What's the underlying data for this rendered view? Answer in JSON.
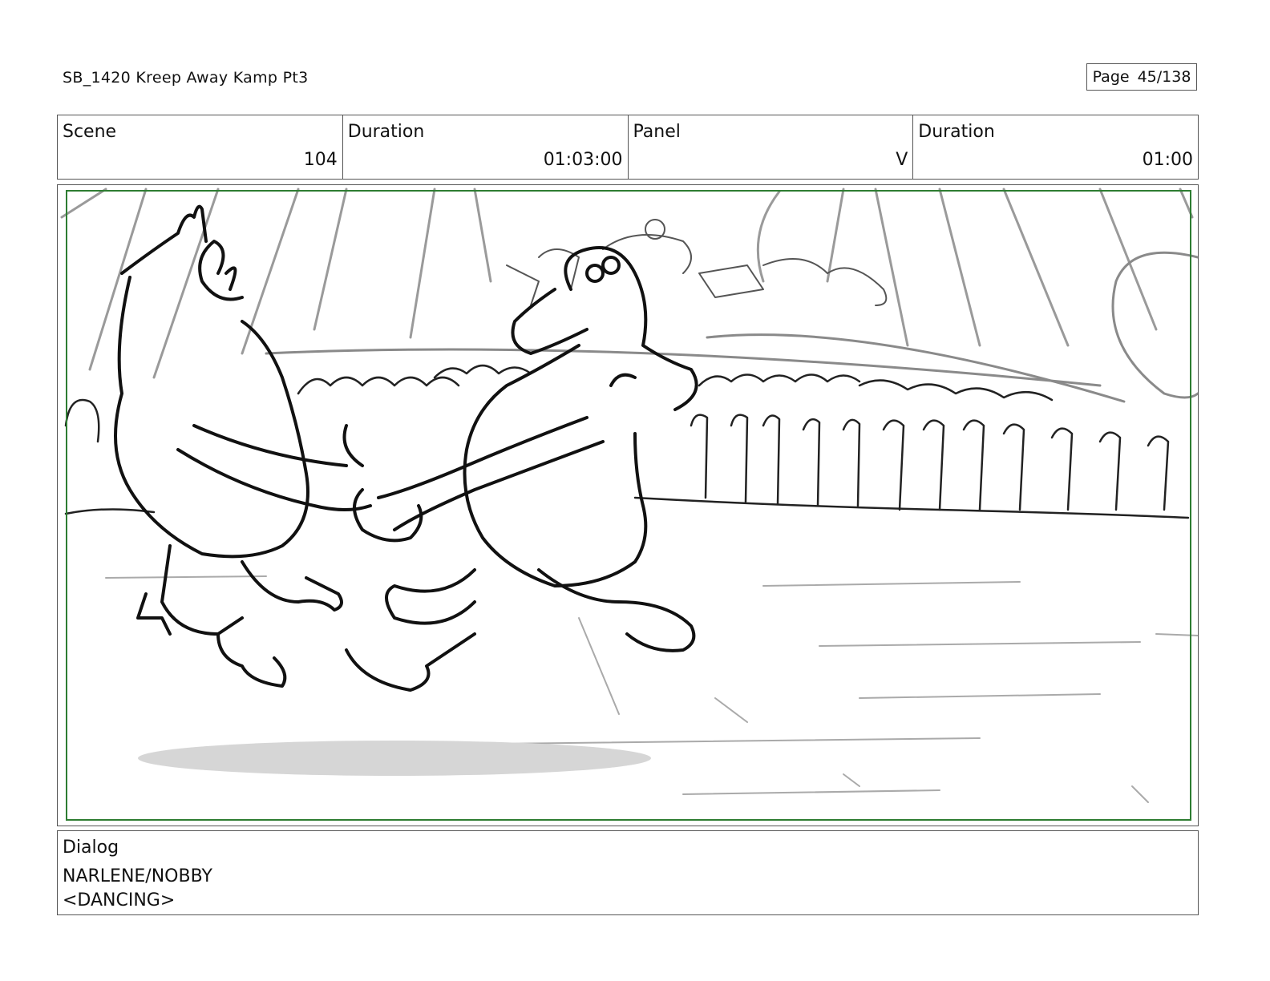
{
  "header": {
    "title": "SB_1420  Kreep Away Kamp Pt3",
    "page_label": "Page",
    "page_value": "45/138"
  },
  "info": {
    "scene_label": "Scene",
    "scene_value": "104",
    "duration_label": "Duration",
    "duration_value": "01:03:00",
    "panel_label": "Panel",
    "panel_value": "V",
    "panel_duration_label": "Duration",
    "panel_duration_value": "01:00"
  },
  "dialog": {
    "label": "Dialog",
    "lines": [
      "NARLENE/NOBBY",
      "<DANCING>"
    ]
  },
  "colors": {
    "safe_frame": "#2e7d32",
    "border": "#555555",
    "sketch_line": "#111111",
    "sketch_light": "#9a9a9a",
    "shadow": "#d6d6d6"
  }
}
